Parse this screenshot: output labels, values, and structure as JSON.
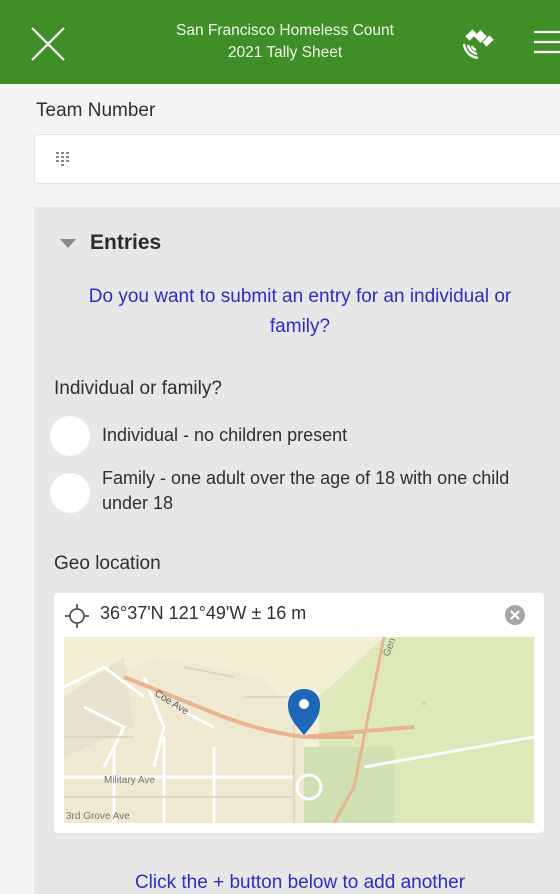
{
  "header": {
    "title_line1": "San Francisco Homeless Count",
    "title_line2": "2021 Tally Sheet",
    "close_icon": "close-icon",
    "gps_icon": "satellite-gps-icon",
    "menu_icon": "hamburger-menu-icon",
    "bg_color": "#3f8e28"
  },
  "team": {
    "label": "Team Number",
    "value": "",
    "placeholder": "",
    "icon": "numeric-keypad-icon"
  },
  "entries": {
    "label": "Entries",
    "note_top": "Do you want to submit an entry for an individual or family?",
    "question": "Individual or family?",
    "options": [
      {
        "label": "Individual - no children present",
        "selected": false
      },
      {
        "label": "Family - one adult over the age of 18 with one child under 18",
        "selected": false
      }
    ],
    "note_color": "#2c2cc8"
  },
  "geo": {
    "label": "Geo location",
    "coords": "36°37'N 121°49'W ± 16 m",
    "map_labels": {
      "street1": "Coe Ave",
      "street2": "Military Ave",
      "street3": "3rd Grove Ave",
      "street4": "Gen"
    }
  },
  "footer_note": "Click the + button below to add another"
}
